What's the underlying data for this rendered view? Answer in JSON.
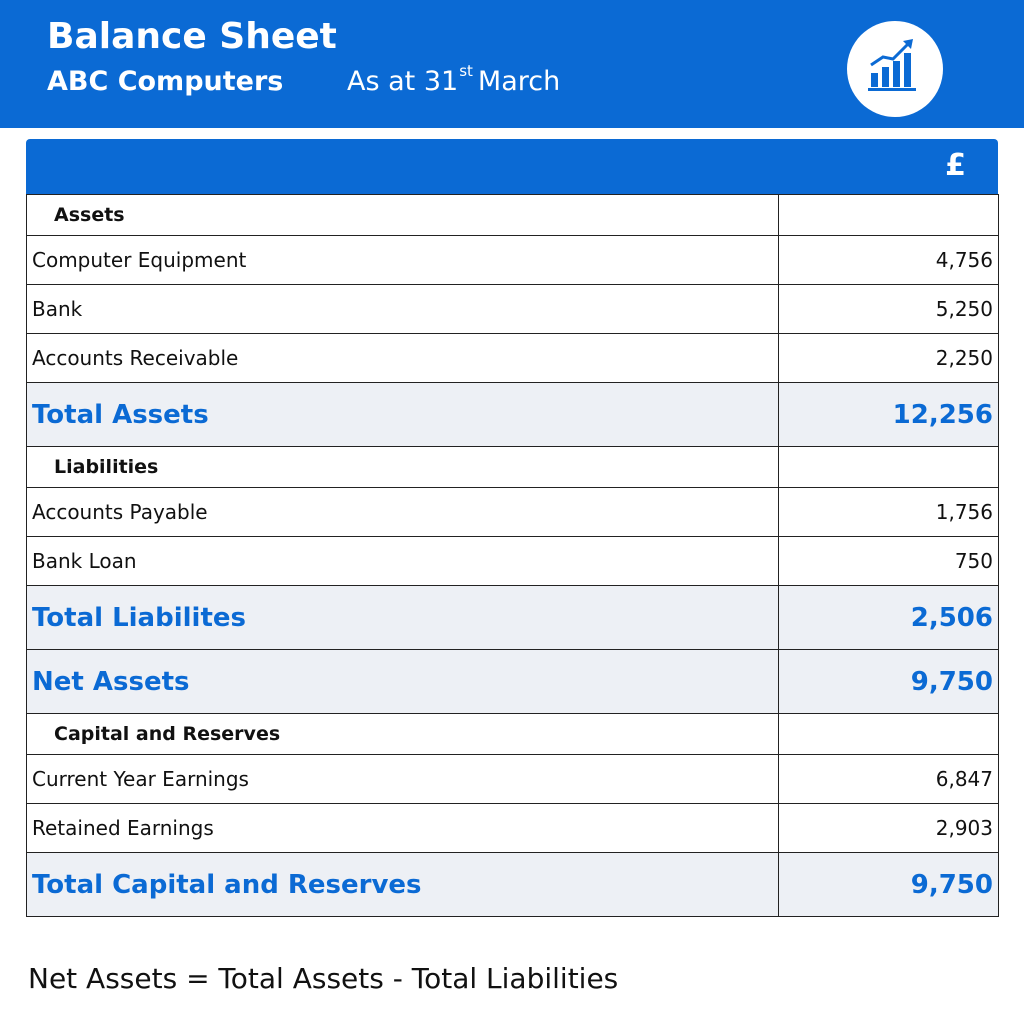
{
  "header": {
    "title": "Balance Sheet",
    "company": "ABC Computers",
    "date_prefix": "As at 31",
    "date_suffix": "st",
    "date_month": "March",
    "logo_icon": "bar-chart-growth-icon",
    "background_color": "#0b6ad4"
  },
  "table": {
    "currency_header": "£",
    "sections": {
      "assets": {
        "heading": "Assets",
        "items": [
          {
            "label": "Computer Equipment",
            "amount": "4,756"
          },
          {
            "label": "Bank",
            "amount": "5,250"
          },
          {
            "label": "Accounts Receivable",
            "amount": "2,250"
          }
        ],
        "total": {
          "label": "Total Assets",
          "amount": "12,256"
        }
      },
      "liabilities": {
        "heading": "Liabilities",
        "items": [
          {
            "label": "Accounts Payable",
            "amount": "1,756"
          },
          {
            "label": "Bank Loan",
            "amount": "750"
          }
        ],
        "total": {
          "label": "Total Liabilites",
          "amount": "2,506"
        }
      },
      "net_assets": {
        "label": "Net Assets",
        "amount": "9,750"
      },
      "capital": {
        "heading": "Capital and Reserves",
        "items": [
          {
            "label": "Current Year Earnings",
            "amount": "6,847"
          },
          {
            "label": "Retained Earnings",
            "amount": "2,903"
          }
        ],
        "total": {
          "label": "Total Capital and Reserves",
          "amount": "9,750"
        }
      }
    },
    "accent_color": "#0b6ad4",
    "total_row_background": "#edf0f5"
  },
  "footer": {
    "note": "Net Assets = Total Assets - Total Liabilities"
  }
}
